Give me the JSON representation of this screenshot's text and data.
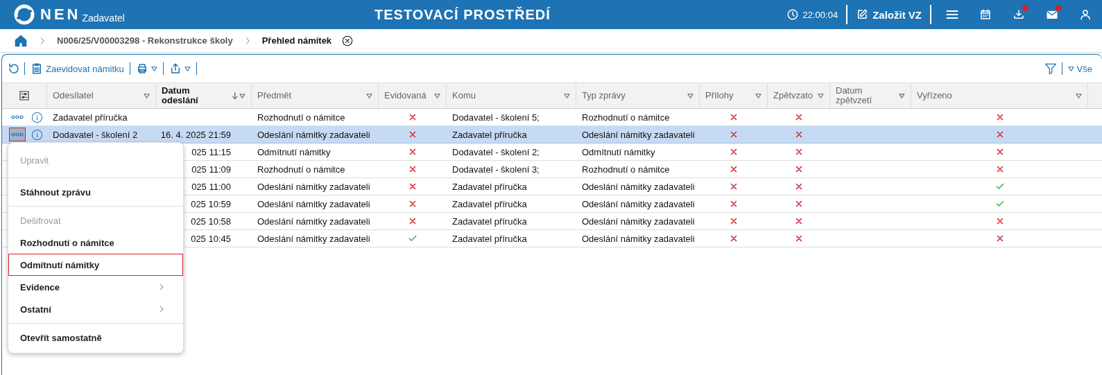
{
  "header": {
    "logo": "NEN",
    "subtitle": "Zadavatel",
    "environment": "TESTOVACÍ PROSTŘEDÍ",
    "time": "22:00:04",
    "create_button": "Založit VZ",
    "notifications": {
      "downloads": true,
      "messages": true
    }
  },
  "breadcrumb": [
    {
      "label": "N006/25/V00003298 - Rekonstrukce školy",
      "current": false
    },
    {
      "label": "Přehled námitek",
      "current": true
    }
  ],
  "toolbar": {
    "register_button": "Zaevidovat námitku",
    "filter_label": "Vše"
  },
  "table": {
    "columns": [
      {
        "label": "Odesílatel",
        "sorted": false
      },
      {
        "label": "Datum odeslání",
        "sorted": true
      },
      {
        "label": "Předmět",
        "sorted": false
      },
      {
        "label": "Evidovaná",
        "sorted": false
      },
      {
        "label": "Komu",
        "sorted": false
      },
      {
        "label": "Typ zprávy",
        "sorted": false
      },
      {
        "label": "Přílohy",
        "sorted": false
      },
      {
        "label": "Zpětvzato",
        "sorted": false
      },
      {
        "label": "Datum zpětvzetí",
        "sorted": false
      },
      {
        "label": "Vyřízeno",
        "sorted": false
      }
    ],
    "rows": [
      {
        "selected": false,
        "sender": "Zadavatel příručka",
        "date": "",
        "subject": "Rozhodnutí o námitce",
        "registered": false,
        "to": "Dodavatel - školení 5;",
        "type": "Rozhodnutí o námitce",
        "attachments": false,
        "withdrawn": false,
        "resolved": false
      },
      {
        "selected": true,
        "sender": "Dodavatel - školení 2",
        "date": "16. 4. 2025 21:59",
        "subject": "Odeslání námitky zadavateli",
        "registered": false,
        "to": "Zadavatel příručka",
        "type": "Odeslání námitky zadavateli",
        "attachments": false,
        "withdrawn": false,
        "resolved": false
      },
      {
        "selected": false,
        "date": "025 11:15",
        "subject": "Odmítnutí námitky",
        "registered": false,
        "to": "Dodavatel - školení 2;",
        "type": "Odmítnutí námitky",
        "attachments": false,
        "withdrawn": false,
        "resolved": false
      },
      {
        "selected": false,
        "date": "025 11:09",
        "subject": "Rozhodnutí o námitce",
        "registered": false,
        "to": "Dodavatel - školení 3;",
        "type": "Rozhodnutí o námitce",
        "attachments": false,
        "withdrawn": false,
        "resolved": false
      },
      {
        "selected": false,
        "date": "025 11:00",
        "subject": "Odeslání námitky zadavateli",
        "registered": false,
        "to": "Zadavatel příručka",
        "type": "Odeslání námitky zadavateli",
        "attachments": false,
        "withdrawn": false,
        "resolved": true
      },
      {
        "selected": false,
        "date": "025 10:59",
        "subject": "Odeslání námitky zadavateli",
        "registered": false,
        "to": "Zadavatel příručka",
        "type": "Odeslání námitky zadavateli",
        "attachments": false,
        "withdrawn": false,
        "resolved": true
      },
      {
        "selected": false,
        "date": "025 10:58",
        "subject": "Odeslání námitky zadavateli",
        "registered": false,
        "to": "Zadavatel příručka",
        "type": "Odeslání námitky zadavateli",
        "attachments": false,
        "withdrawn": false,
        "resolved": false
      },
      {
        "selected": false,
        "date": "025 10:45",
        "subject": "Odeslání námitky zadavateli",
        "registered": true,
        "to": "Zadavatel příručka",
        "type": "Odeslání námitky zadavateli",
        "attachments": false,
        "withdrawn": false,
        "resolved": false
      }
    ]
  },
  "context_menu": [
    {
      "kind": "item",
      "label": "Upravit",
      "disabled": true,
      "selected": false,
      "submenu": false
    },
    {
      "kind": "separator"
    },
    {
      "kind": "item",
      "label": "Stáhnout zprávu",
      "disabled": false,
      "selected": false,
      "submenu": false
    },
    {
      "kind": "separator"
    },
    {
      "kind": "item",
      "label": "Dešifrovat",
      "disabled": true,
      "selected": false,
      "submenu": false
    },
    {
      "kind": "item",
      "label": "Rozhodnutí o námitce",
      "disabled": false,
      "selected": false,
      "submenu": false
    },
    {
      "kind": "item",
      "label": "Odmítnutí námitky",
      "disabled": false,
      "selected": true,
      "submenu": false
    },
    {
      "kind": "item",
      "label": "Evidence",
      "disabled": false,
      "selected": false,
      "submenu": true
    },
    {
      "kind": "item",
      "label": "Ostatní",
      "disabled": false,
      "selected": false,
      "submenu": true
    },
    {
      "kind": "separator"
    },
    {
      "kind": "item",
      "label": "Otevřít samostatně",
      "disabled": false,
      "selected": false,
      "submenu": false
    }
  ]
}
